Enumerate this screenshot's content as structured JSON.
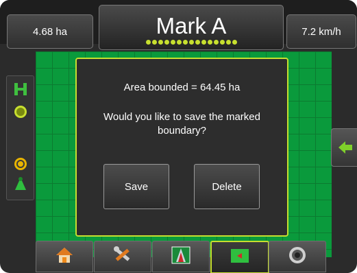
{
  "header": {
    "left_value": "4.68 ha",
    "title": "Mark A",
    "right_value": "7.2 km/h"
  },
  "dialog": {
    "line1": "Area bounded = 64.45 ha",
    "line2": "Would you like to save the marked",
    "line3": "boundary?",
    "save_label": "Save",
    "delete_label": "Delete"
  },
  "colors": {
    "accent": "#c7df2f",
    "field": "#0a9a3c",
    "background": "#2b2b2b"
  },
  "left_panel_icons": [
    "boom-status-icon",
    "section-count-icon",
    "steering-icon",
    "vehicle-icon"
  ],
  "right_button_icon": "arrow-left-icon",
  "bottom_tabs": [
    "home-icon",
    "tools-icon",
    "guidance-icon",
    "mapping-icon",
    "camera-icon"
  ]
}
